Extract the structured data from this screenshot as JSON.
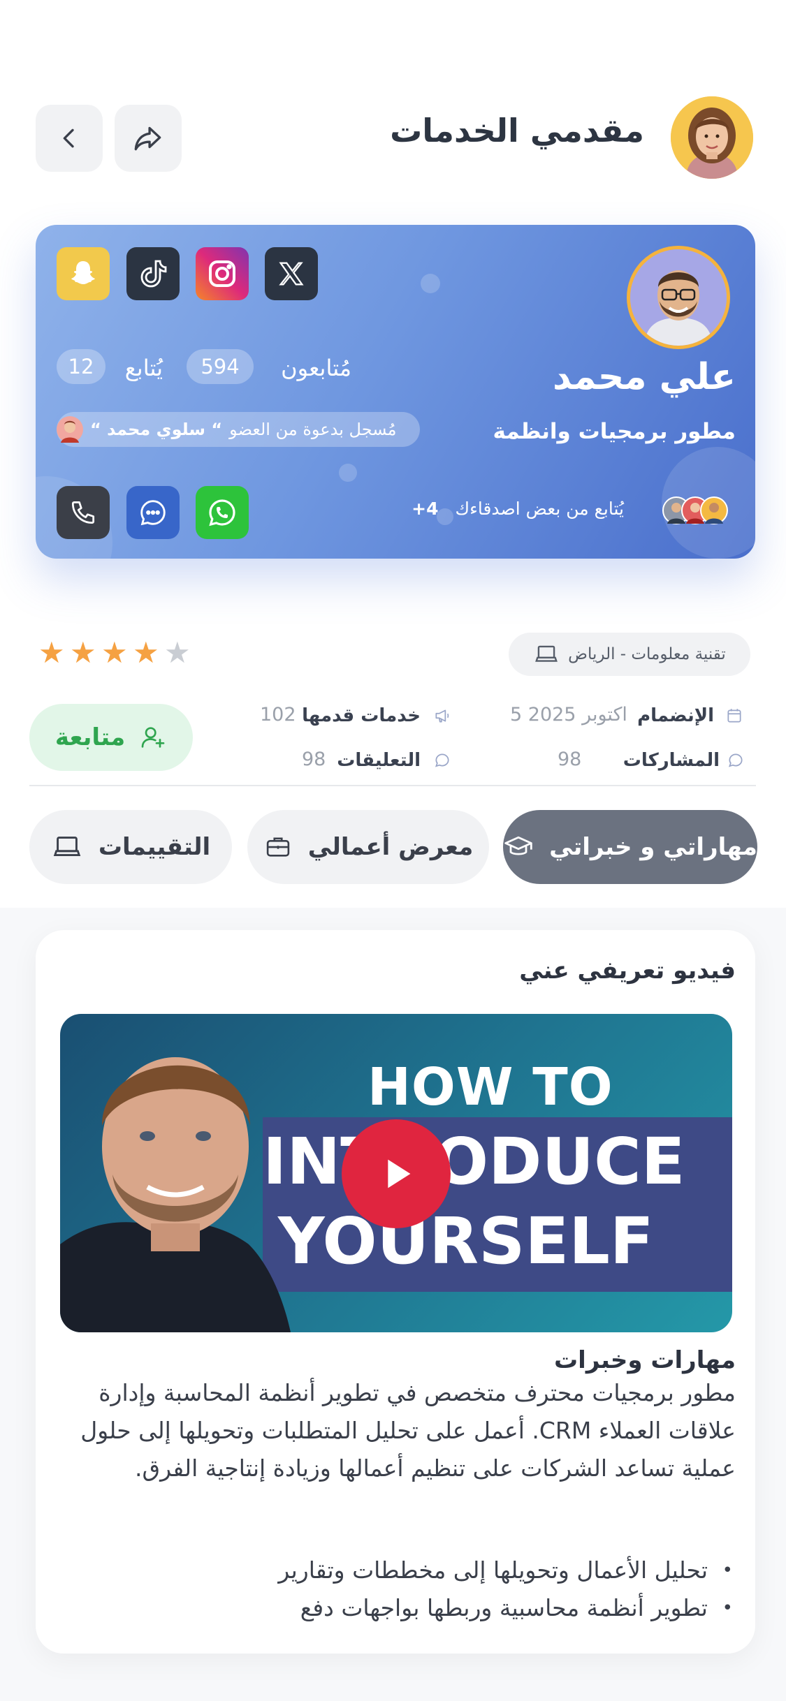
{
  "header": {
    "title": "مقدمي الخدمات"
  },
  "profile": {
    "name": "علي محمد",
    "role": "مطور برمجيات وانظمة",
    "followers_label": "مُتابعون",
    "followers_count": "594",
    "following_label": "يُتابع",
    "following_count": "12",
    "invite_prefix": "مُسجل بدعوة من العضو",
    "invite_name": "“ سلوي محمد “",
    "friends_text": "يُتابع من بعض اصدقاءك",
    "friends_more": "4+",
    "socials": [
      "snapchat-icon",
      "tiktok-icon",
      "instagram-icon",
      "x-icon"
    ],
    "contacts": [
      "phone-icon",
      "chat-icon",
      "whatsapp-icon"
    ]
  },
  "meta": {
    "category": "تقنية معلومات - الرياض",
    "rating": {
      "filled": 4,
      "total": 5
    },
    "joined_label": "الإنضمام",
    "joined_value": "5 اكتوبر 2025",
    "services_label": "خدمات قدمها",
    "services_value": "102",
    "posts_label": "المشاركات",
    "posts_value": "98",
    "comments_label": "التعليقات",
    "comments_value": "98",
    "follow_button": "متابعة"
  },
  "tabs": [
    {
      "label": "مهاراتي و خبراتي",
      "active": true
    },
    {
      "label": "معرض أعمالي",
      "active": false
    },
    {
      "label": "التقييمات",
      "active": false
    }
  ],
  "content": {
    "video_title": "فيديو تعريفي عني",
    "video_caption_line1": "HOW TO",
    "video_caption_line2": "INTRODUCE",
    "video_caption_line3": "YOURSELF",
    "skills_title": "مهارات وخبرات",
    "skills_paragraph": "مطور برمجيات محترف متخصص في تطوير أنظمة المحاسبة وإدارة علاقات العملاء CRM. أعمل على تحليل المتطلبات وتحويلها إلى حلول عملية تساعد الشركات على تنظيم أعمالها وزيادة إنتاجية الفرق.",
    "bullets": [
      "تحليل الأعمال وتحويلها إلى مخططات وتقارير",
      "تطوير أنظمة محاسبية وربطها بواجهات دفع"
    ]
  },
  "colors": {
    "card_gradient_start": "#8fb2ea",
    "card_gradient_end": "#4a6fcc",
    "star_filled": "#f5a142",
    "star_empty": "#c9cdd3",
    "follow_green": "#2fa54f",
    "tab_active": "#6b7280",
    "play_red": "#e0253f"
  }
}
